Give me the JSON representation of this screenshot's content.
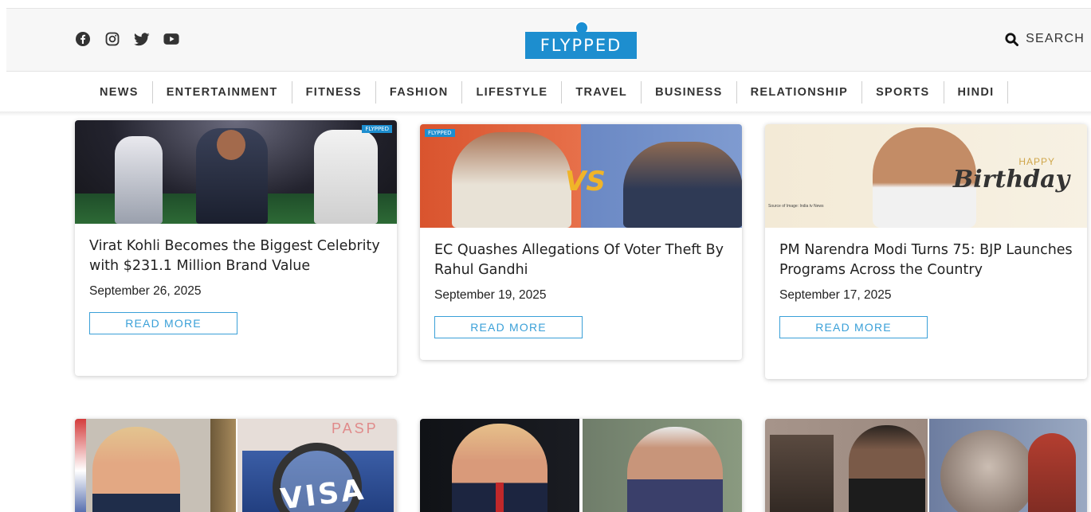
{
  "header": {
    "social_icons": [
      "facebook-icon",
      "instagram-icon",
      "twitter-icon",
      "youtube-icon"
    ],
    "logo_text": "FLYPPED",
    "search_label": "SEARCH"
  },
  "nav": {
    "items": [
      "NEWS",
      "ENTERTAINMENT",
      "FITNESS",
      "FASHION",
      "LIFESTYLE",
      "TRAVEL",
      "BUSINESS",
      "RELATIONSHIP",
      "SPORTS",
      "HINDI"
    ]
  },
  "articles": [
    {
      "title": "Virat Kohli Becomes the Biggest Celebrity with $231.1 Million Brand Value",
      "date": "September 26, 2025",
      "cta": "READ MORE",
      "badge": "FLYPPED"
    },
    {
      "title": "EC Quashes Allegations Of Voter Theft By Rahul Gandhi",
      "date": "September 19, 2025",
      "cta": "READ MORE",
      "badge": "FLYPPED",
      "overlay": "VS"
    },
    {
      "title": "PM Narendra Modi Turns 75: BJP Launches Programs Across the Country",
      "date": "September 17, 2025",
      "cta": "READ MORE",
      "overlay_top": "HAPPY",
      "overlay_main": "Birthday",
      "source": "Source of Image: India tv News"
    },
    {
      "overlay": "VISA",
      "overlay_top": "PASP"
    },
    {},
    {}
  ],
  "colors": {
    "accent": "#1d8ecf",
    "button_border": "#3aa0d8",
    "header_bg": "#f7f7f7"
  }
}
